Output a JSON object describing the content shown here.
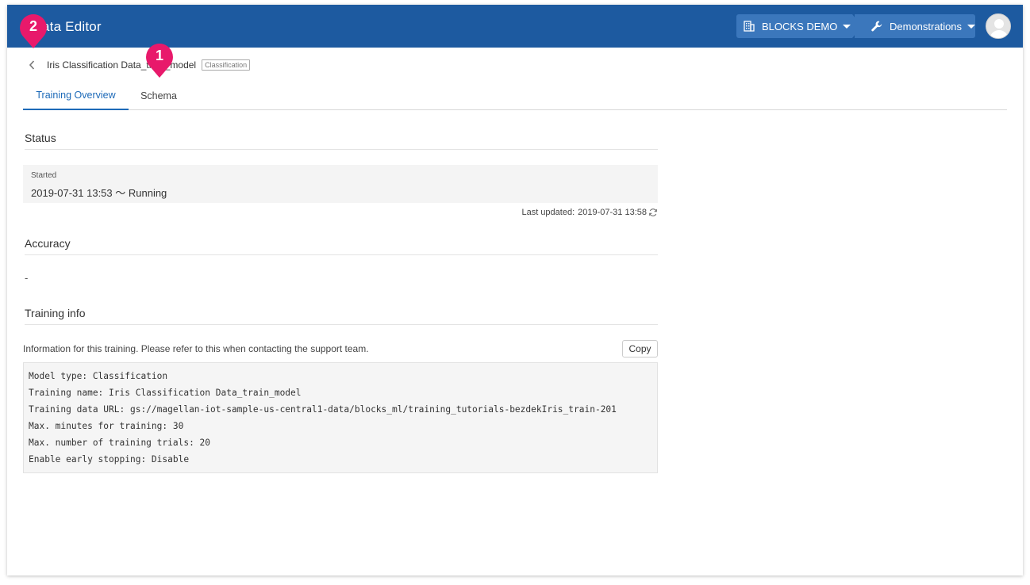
{
  "header": {
    "app_title": "ata Editor",
    "org_label": "BLOCKS DEMO",
    "project_label": "Demonstrations",
    "org_icon": "building-icon",
    "project_icon": "wrench-icon"
  },
  "breadcrumb": {
    "model_name": "Iris Classification Data_train_model",
    "model_type_badge": "Classification"
  },
  "tabs": [
    {
      "label": "Training Overview",
      "active": true
    },
    {
      "label": "Schema",
      "active": false
    }
  ],
  "status": {
    "section_title": "Status",
    "started_label": "Started",
    "started_value": "2019-07-31 13:53 ～ Running",
    "last_updated_label": "Last updated:",
    "last_updated_value": "2019-07-31 13:58"
  },
  "accuracy": {
    "section_title": "Accuracy",
    "value": "-"
  },
  "training_info": {
    "section_title": "Training info",
    "description": "Information for this training. Please refer to this when contacting the support team.",
    "copy_label": "Copy",
    "lines": [
      "Model type: Classification",
      "Training name: Iris Classification Data_train_model",
      "Training data URL: gs://magellan-iot-sample-us-central1-data/blocks_ml/training_tutorials-bezdekIris_train-201",
      "Max. minutes for training: 30",
      "Max. number of training trials: 20",
      "Enable early stopping: Disable"
    ]
  },
  "annotations": [
    {
      "number": "1",
      "color": "#e8196b"
    },
    {
      "number": "2",
      "color": "#e8196b"
    }
  ],
  "colors": {
    "header_bg": "#1d5aa0",
    "header_button_bg": "#3b77bc",
    "accent": "#1d6ab8",
    "marker": "#e8196b"
  }
}
